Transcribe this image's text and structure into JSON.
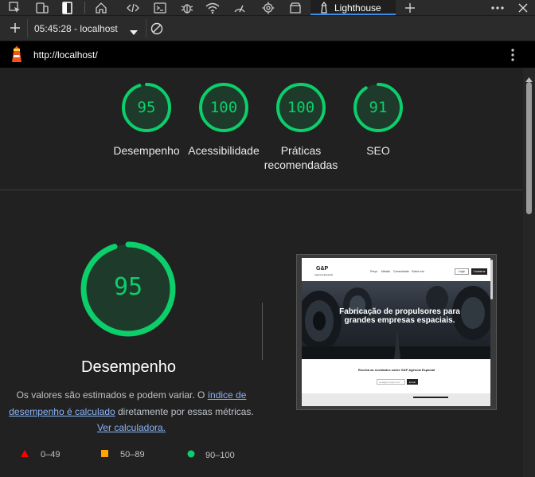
{
  "devtools": {
    "active_tab_label": "Lighthouse",
    "toolbar_icons": [
      "inspect-icon",
      "device-icon",
      "panel-icon",
      "home-icon",
      "code-icon",
      "console-icon",
      "bug-icon",
      "network-icon",
      "performance-icon",
      "settings-icon",
      "application-icon",
      "lighthouse-icon",
      "add-tab-icon",
      "more-icon"
    ]
  },
  "report_bar": {
    "selected_report": "05:45:28 - localhost"
  },
  "url_bar": {
    "url": "http://localhost/"
  },
  "summary": {
    "gauges": [
      {
        "score": "95",
        "label": "Desempenho",
        "fraction": 0.95
      },
      {
        "score": "100",
        "label": "Acessibilidade",
        "fraction": 1.0
      },
      {
        "score": "100",
        "label": "Práticas recomendadas",
        "fraction": 1.0
      },
      {
        "score": "91",
        "label": "SEO",
        "fraction": 0.91
      }
    ]
  },
  "performance": {
    "score": "95",
    "fraction": 0.95,
    "title": "Desempenho",
    "desc_1": "Os valores são estimados e podem variar. O ",
    "desc_link_1": "índice de desempenho é calculado",
    "desc_2": " diretamente por essas métricas. ",
    "desc_link_2": "Ver calculadora."
  },
  "legend": {
    "fail": "0–49",
    "average": "50–89",
    "pass": "90–100"
  },
  "screenshot": {
    "logo": "G&P",
    "logo_sub": "Agência Espacial",
    "nav": [
      "Preço",
      "Missão",
      "Comunidade",
      "Sobre nós"
    ],
    "login": "Login",
    "signup": "Cadastrar",
    "hero_text": "Fabricação de propulsores para grandes empresas espaciais.",
    "newsletter": "Receba as novidades sobre G&P Agência Espacial",
    "email_placeholder": "email@exemplo.com",
    "send": "Enviar"
  },
  "colors": {
    "pass": "#0cce6b",
    "average": "#ffa400",
    "fail": "#ff0000",
    "link": "#8ab4f8"
  }
}
